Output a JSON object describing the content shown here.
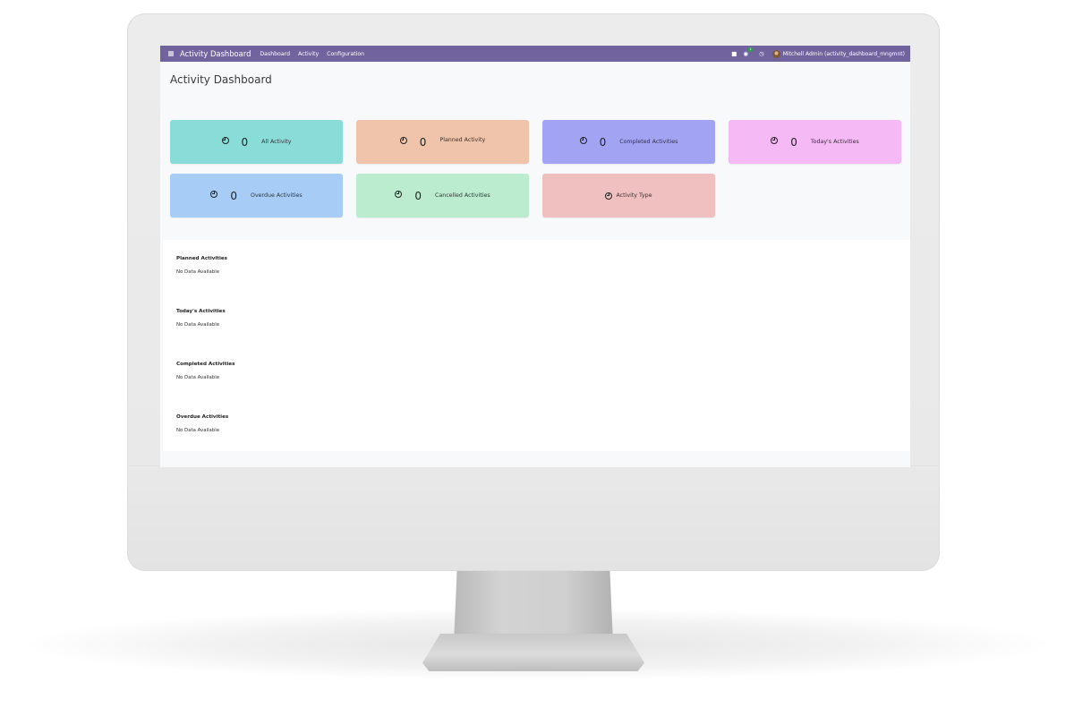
{
  "navbar": {
    "app_title": "Activity Dashboard",
    "menu": [
      "Dashboard",
      "Activity",
      "Configuration"
    ],
    "message_count": "1",
    "user": "Mitchell Admin (activity_dashboard_mngmnt)"
  },
  "page": {
    "title": "Activity Dashboard"
  },
  "cards": [
    {
      "count": "0",
      "label": "All Activity",
      "color": "#8adcd9"
    },
    {
      "count": "0",
      "label": "Planned Activity",
      "color": "#f0c4aa"
    },
    {
      "count": "0",
      "label": "Completed Activities",
      "color": "#a3a3f3"
    },
    {
      "count": "0",
      "label": "Today's Activities",
      "color": "#f5b9f5"
    },
    {
      "count": "0",
      "label": "Overdue Activities",
      "color": "#a7cdf6"
    },
    {
      "count": "0",
      "label": "Cancelled Activities",
      "color": "#bcecd0"
    },
    {
      "label": "Activity Type",
      "color": "#f0bfbf"
    }
  ],
  "lists": [
    {
      "title": "Planned Activities",
      "empty_text": "No Data Available"
    },
    {
      "title": "Today's Activities",
      "empty_text": "No Data Available"
    },
    {
      "title": "Completed Activities",
      "empty_text": "No Data Available"
    },
    {
      "title": "Overdue Activities",
      "empty_text": "No Data Available"
    }
  ],
  "colors": {
    "navbar": "#71639e",
    "screen_bg": "#f8f9fa"
  }
}
